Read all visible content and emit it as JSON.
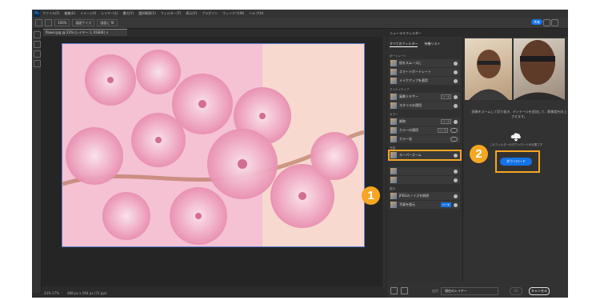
{
  "menubar": {
    "logo": "Ps",
    "items": [
      "ファイル(F)",
      "編集(E)",
      "イメージ(I)",
      "レイヤー(L)",
      "書式(Y)",
      "選択範囲(S)",
      "フィルター(T)",
      "表示(V)",
      "プラグイン",
      "ウィンドウ(W)",
      "ヘルプ(H)"
    ]
  },
  "options": {
    "zoom": "100%",
    "fit_label": "画面サイズ",
    "fill_label": "画面に fit",
    "share_label": "共有"
  },
  "document": {
    "tab_label": "flower.jpg @ 23% (レイヤー 1, RGB/8) ×"
  },
  "status": {
    "zoom": "23% 27%",
    "size": "888 px x 594 px (72 ppi)"
  },
  "filters": {
    "panel_title": "ニューラルフィルター",
    "tabs": [
      "すべてのフィルター",
      "待機リスト"
    ],
    "categories": [
      {
        "name": "ポートレート",
        "items": [
          {
            "label": "肌をスムーズに",
            "badge": "",
            "control": "icon"
          },
          {
            "label": "スマートポートレート",
            "badge": "",
            "control": "icon"
          },
          {
            "label": "メイクアップを適用",
            "badge": "",
            "control": "icon"
          }
        ]
      },
      {
        "name": "クリエイティブ",
        "items": [
          {
            "label": "風景ミキサー",
            "badge": "ベータ",
            "control": "icon"
          },
          {
            "label": "スタイルの適用",
            "badge": "",
            "control": "icon"
          }
        ]
      },
      {
        "name": "カラー",
        "items": [
          {
            "label": "調和",
            "badge": "ベータ",
            "control": "icon"
          },
          {
            "label": "カラーの適用",
            "badge": "ベータ",
            "control": "toggle"
          },
          {
            "label": "カラー化",
            "badge": "",
            "control": "toggle"
          }
        ]
      },
      {
        "name": "写真",
        "items": [
          {
            "label": "スーパーズーム",
            "badge": "",
            "control": "icon"
          }
        ]
      },
      {
        "name": "",
        "items": [
          {
            "label": "",
            "badge": "",
            "control": "icon"
          },
          {
            "label": "",
            "badge": "",
            "control": "icon"
          }
        ]
      },
      {
        "name": "復元",
        "items": [
          {
            "label": "JPEGのノイズを削除",
            "badge": "",
            "control": "icon"
          },
          {
            "label": "写真を復元",
            "badge": "ベータ",
            "control": "icon"
          }
        ]
      }
    ]
  },
  "preview": {
    "description": "画像をズームして切り抜き、ディテールを追加して、解像度を向上させます。",
    "download_note": "このフィルターのダウンロードが必要です",
    "download_label": "ダウンロード"
  },
  "bottom": {
    "output_label": "出力",
    "output_value": "現在のレイヤー",
    "ok_label": "OK",
    "cancel_label": "キャンセル"
  },
  "markers": [
    "1",
    "2"
  ],
  "colors": {
    "accent": "#f5a623",
    "brand": "#1473e6"
  }
}
